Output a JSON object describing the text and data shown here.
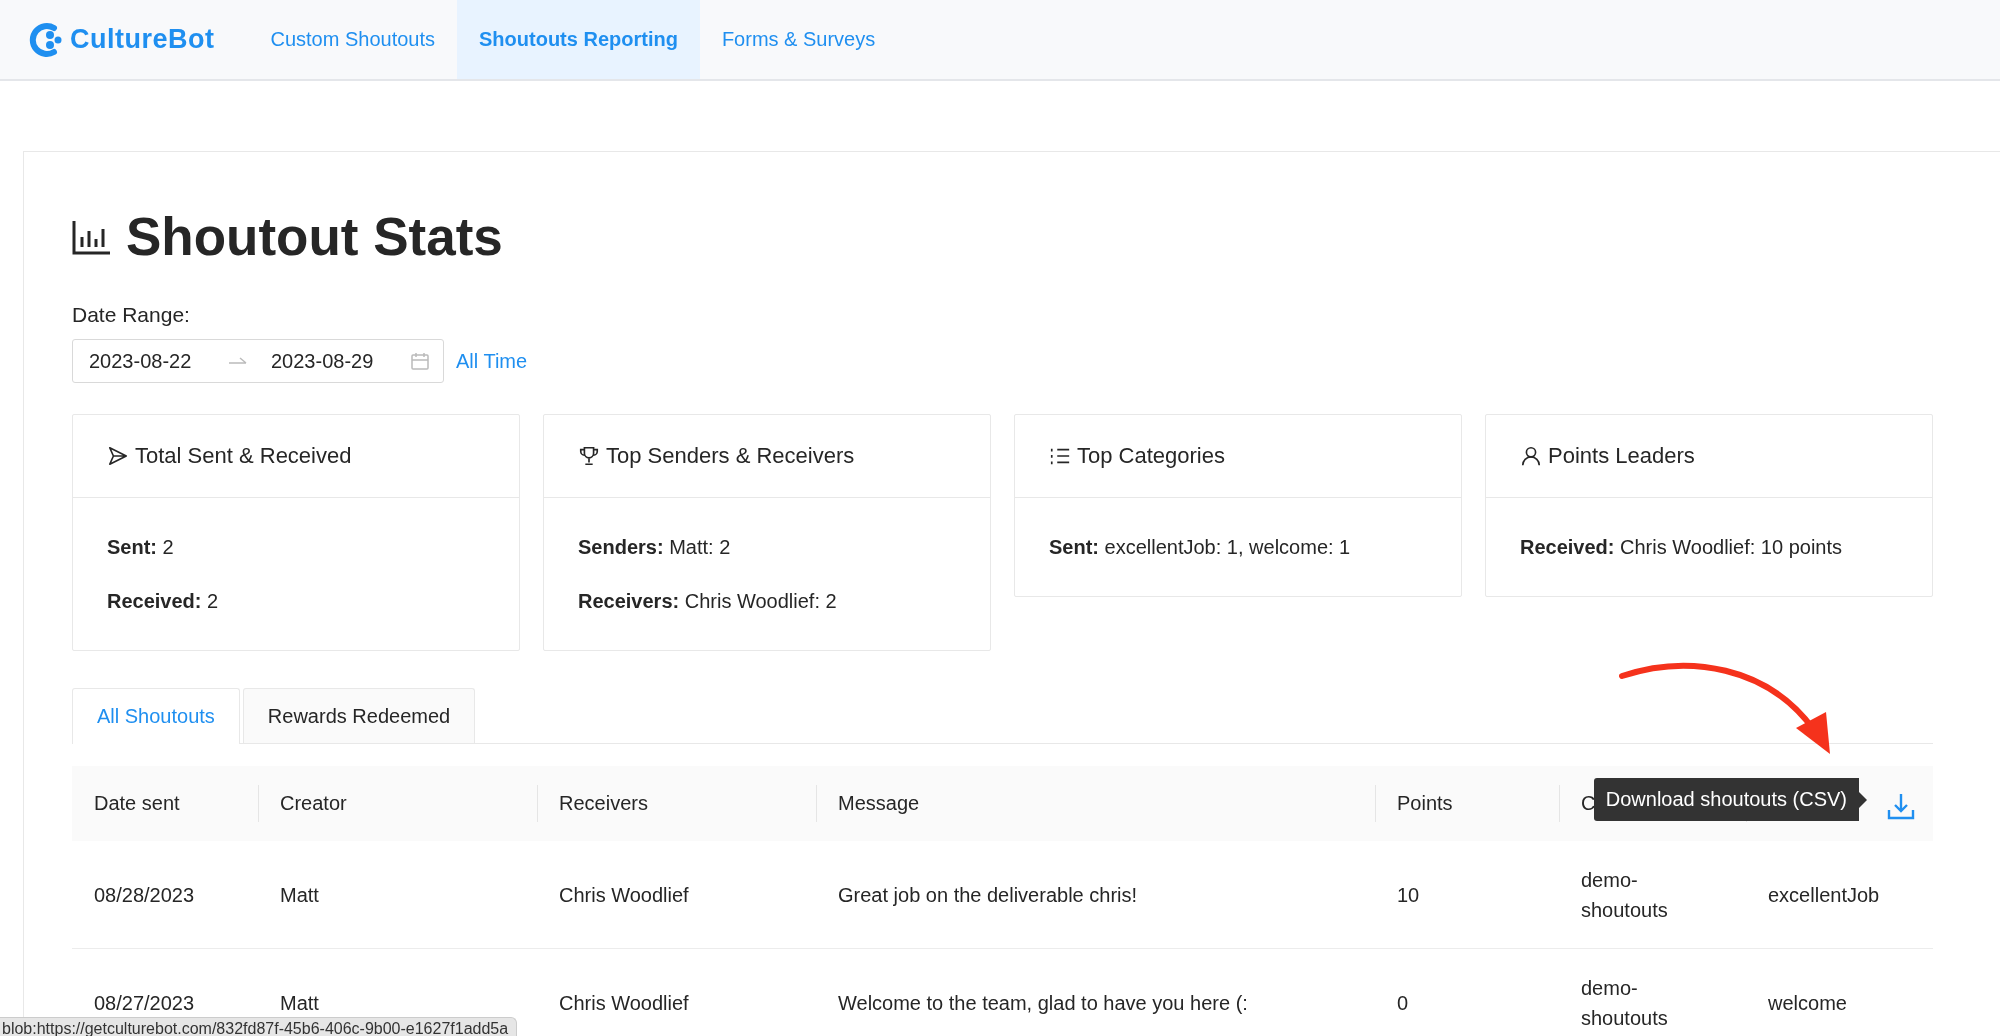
{
  "brand": {
    "name": "CultureBot"
  },
  "nav": [
    {
      "label": "Custom Shoutouts",
      "selected": false
    },
    {
      "label": "Shoutouts Reporting",
      "selected": true
    },
    {
      "label": "Forms & Surveys",
      "selected": false
    }
  ],
  "page": {
    "title": "Shoutout Stats",
    "date_range": {
      "label": "Date Range:",
      "start": "2023-08-22",
      "end": "2023-08-29",
      "shortcut": "All Time"
    }
  },
  "cards": [
    {
      "kind": "send",
      "title": "Total Sent & Received",
      "lines": [
        "**Sent:** 2",
        "**Received:** 2"
      ]
    },
    {
      "kind": "trophy",
      "title": "Top Senders & Receivers",
      "lines": [
        "**Senders:** Matt: 2",
        "**Receivers:** Chris Woodlief: 2"
      ]
    },
    {
      "kind": "list",
      "title": "Top Categories",
      "lines": [
        "**Sent:** excellentJob: 1, welcome: 1"
      ]
    },
    {
      "kind": "user",
      "title": "Points Leaders",
      "lines": [
        "**Received:** Chris Woodlief: 10 points"
      ]
    }
  ],
  "tabs": [
    {
      "label": "All Shoutouts",
      "selected": true
    },
    {
      "label": "Rewards Redeemed",
      "selected": false
    }
  ],
  "table": {
    "columns": [
      "Date sent",
      "Creator",
      "Receivers",
      "Message",
      "Points",
      "C"
    ],
    "rows": [
      {
        "cells": [
          "08/28/2023",
          "Matt",
          "Chris Woodlief",
          "Great job on the deliverable chris!",
          "10",
          "demo-shoutouts",
          "excellentJob"
        ]
      },
      {
        "cells": [
          "08/27/2023",
          "Matt",
          "Chris Woodlief",
          "Welcome to the team, glad to have you here (:",
          "0",
          "demo-shoutouts",
          "welcome"
        ]
      }
    ]
  },
  "tooltip": {
    "text": "Download shoutouts (CSV)"
  },
  "status_bar": {
    "text": "blob:https://getculturebot.com/832fd87f-45b6-406c-9b00-e1627f1add5a"
  }
}
